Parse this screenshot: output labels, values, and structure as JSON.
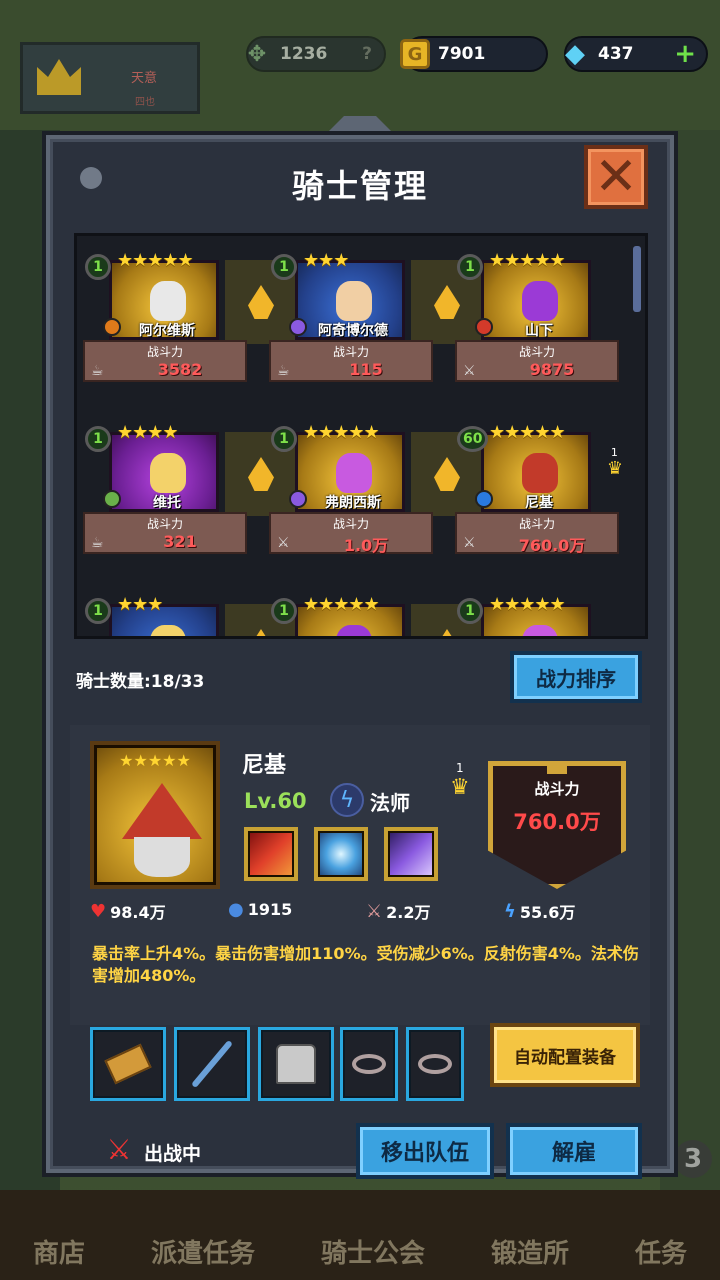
{
  "hud": {
    "laurel_value": "1236",
    "gold": "7901",
    "gems": "437",
    "crown_text_1": "天意",
    "crown_text_2": "四也"
  },
  "panel": {
    "title": "骑士管理"
  },
  "roster": {
    "power_label": "战斗力",
    "knights": [
      {
        "name": "阿尔维斯",
        "level": "1",
        "stars": "★★★★★",
        "power": "3582",
        "status_icon": "rest-icon",
        "class_color": "#e07a1a",
        "portrait": "gold",
        "face_color": "#e8e8e8"
      },
      {
        "name": "阿奇博尔德",
        "level": "1",
        "stars": "★★★",
        "power": "115",
        "status_icon": "rest-icon",
        "class_color": "#8a5ae0",
        "portrait": "blue",
        "face_color": "#f1cfa4"
      },
      {
        "name": "山下",
        "level": "1",
        "stars": "★★★★★",
        "power": "9875",
        "status_icon": "swords-icon",
        "class_color": "#d33a2a",
        "portrait": "gold",
        "face_color": "#9b3ad6"
      },
      {
        "name": "维托",
        "level": "1",
        "stars": "★★★★",
        "power": "321",
        "status_icon": "rest-icon",
        "class_color": "#6ab04a",
        "portrait": "purple",
        "face_color": "#f3d26a"
      },
      {
        "name": "弗朗西斯",
        "level": "1",
        "stars": "★★★★★",
        "power": "1.0万",
        "status_icon": "swords-icon",
        "class_color": "#8a5ae0",
        "portrait": "gold",
        "face_color": "#c85ae0"
      },
      {
        "name": "尼基",
        "level": "60",
        "stars": "★★★★★",
        "power": "760.0万",
        "status_icon": "swords-icon",
        "class_color": "#2a7ae0",
        "portrait": "gold",
        "face_color": "#c23a2a"
      },
      {
        "name": "",
        "level": "1",
        "stars": "★★★",
        "power": "",
        "status_icon": "",
        "class_color": "#8a5ae0",
        "portrait": "blue",
        "face_color": "#f3d26a"
      },
      {
        "name": "",
        "level": "1",
        "stars": "★★★★★",
        "power": "",
        "status_icon": "",
        "class_color": "#8a5ae0",
        "portrait": "gold",
        "face_color": "#9b3ad6"
      },
      {
        "name": "",
        "level": "1",
        "stars": "★★★★★",
        "power": "",
        "status_icon": "",
        "class_color": "#8a5ae0",
        "portrait": "gold",
        "face_color": "#c85ae0"
      }
    ],
    "selected_badge": "1"
  },
  "knight_count": "骑士数量:18/33",
  "sort_button": "战力排序",
  "detail": {
    "stars": "★★★★★",
    "name": "尼基",
    "level": "Lv.60",
    "class": "法师",
    "badge_number": "1",
    "power_label": "战斗力",
    "power_value": "760.0万",
    "stats": {
      "hp": "98.4万",
      "mana": "1915",
      "attack": "2.2万",
      "speed": "55.6万"
    },
    "description": "暴击率上升4%。暴击伤害增加110%。受伤减少6%。反射伤害4%。法术伤害增加480%。"
  },
  "auto_equip_button": "自动配置装备",
  "deploy_status": "出战中",
  "leave_team_button": "移出队伍",
  "dismiss_button": "解雇",
  "bottom_nav": [
    "商店",
    "派遣任务",
    "骑士公会",
    "锻造所",
    "任务"
  ],
  "corner_badge": "3",
  "colors": {
    "accent_blue": "#3aa2e0",
    "gold_button": "#f4c542",
    "power_red": "#ff5a5a",
    "desc_yellow": "#ffd445"
  }
}
